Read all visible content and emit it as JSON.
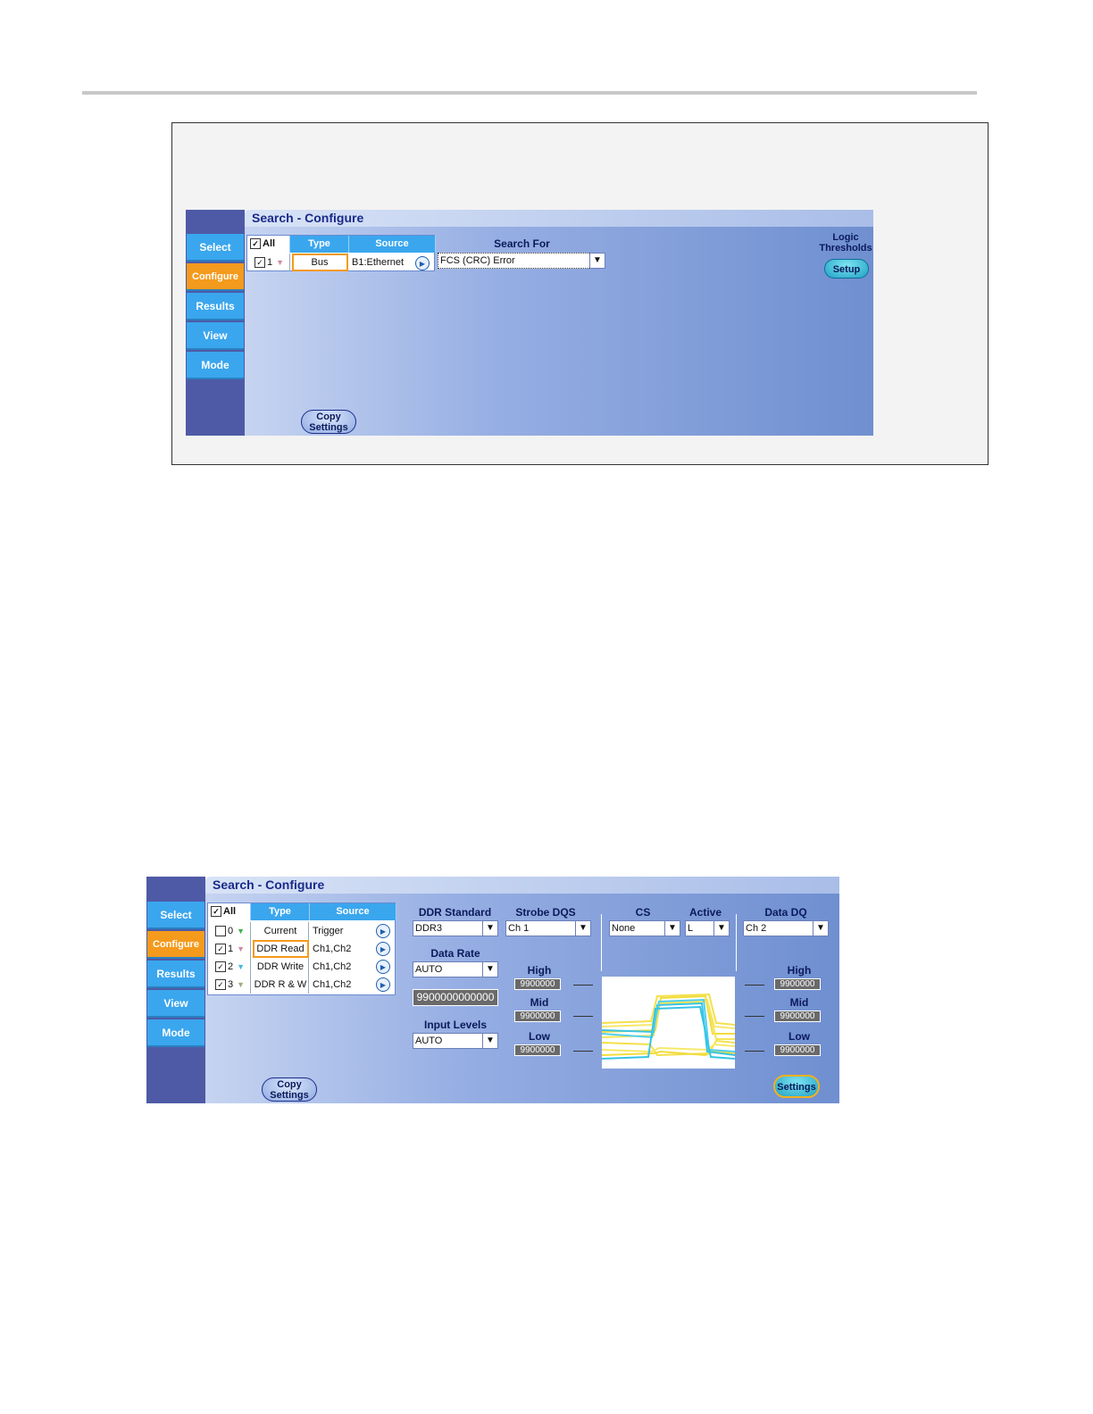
{
  "panel1": {
    "title": "Search - Configure",
    "tabs": [
      "Select",
      "Configure",
      "Results",
      "View",
      "Mode"
    ],
    "table": {
      "headers": {
        "all": "All",
        "type": "Type",
        "source": "Source"
      },
      "rows": [
        {
          "num": "1",
          "type": "Bus",
          "source": "B1:Ethernet"
        }
      ]
    },
    "search_for_label": "Search For",
    "search_for_value": "FCS (CRC) Error",
    "logic_thresholds_label_1": "Logic",
    "logic_thresholds_label_2": "Thresholds",
    "setup_button": "Setup",
    "copy_settings_1": "Copy",
    "copy_settings_2": "Settings"
  },
  "panel2": {
    "title": "Search - Configure",
    "tabs": [
      "Select",
      "Configure",
      "Results",
      "View",
      "Mode"
    ],
    "table": {
      "headers": {
        "all": "All",
        "type": "Type",
        "source": "Source"
      },
      "rows": [
        {
          "num": "0",
          "type": "Current",
          "source": "Trigger",
          "checked": false
        },
        {
          "num": "1",
          "type": "DDR Read",
          "source": "Ch1,Ch2",
          "checked": true
        },
        {
          "num": "2",
          "type": "DDR Write",
          "source": "Ch1,Ch2",
          "checked": true
        },
        {
          "num": "3",
          "type": "DDR R & W",
          "source": "Ch1,Ch2",
          "checked": true
        }
      ]
    },
    "ddr_standard_label": "DDR Standard",
    "ddr_standard_value": "DDR3",
    "strobe_label": "Strobe DQS",
    "strobe_value": "Ch 1",
    "cs_label": "CS",
    "cs_value": "None",
    "active_label": "Active",
    "active_value": "L",
    "data_dq_label": "Data DQ",
    "data_dq_value": "Ch 2",
    "data_rate_label": "Data Rate",
    "data_rate_value": "AUTO",
    "data_rate_number": "9900000000000",
    "input_levels_label": "Input Levels",
    "input_levels_value": "AUTO",
    "left_levels": {
      "high_label": "High",
      "high": "9900000",
      "mid_label": "Mid",
      "mid": "9900000",
      "low_label": "Low",
      "low": "9900000"
    },
    "right_levels": {
      "high_label": "High",
      "high": "9900000",
      "mid_label": "Mid",
      "mid": "9900000",
      "low_label": "Low",
      "low": "9900000"
    },
    "copy_settings_1": "Copy",
    "copy_settings_2": "Settings",
    "settings_button": "Settings"
  },
  "colors": {
    "accent_blue": "#3aa6ee",
    "active_orange": "#f49a1c",
    "sidebar": "#4e5aa6"
  }
}
